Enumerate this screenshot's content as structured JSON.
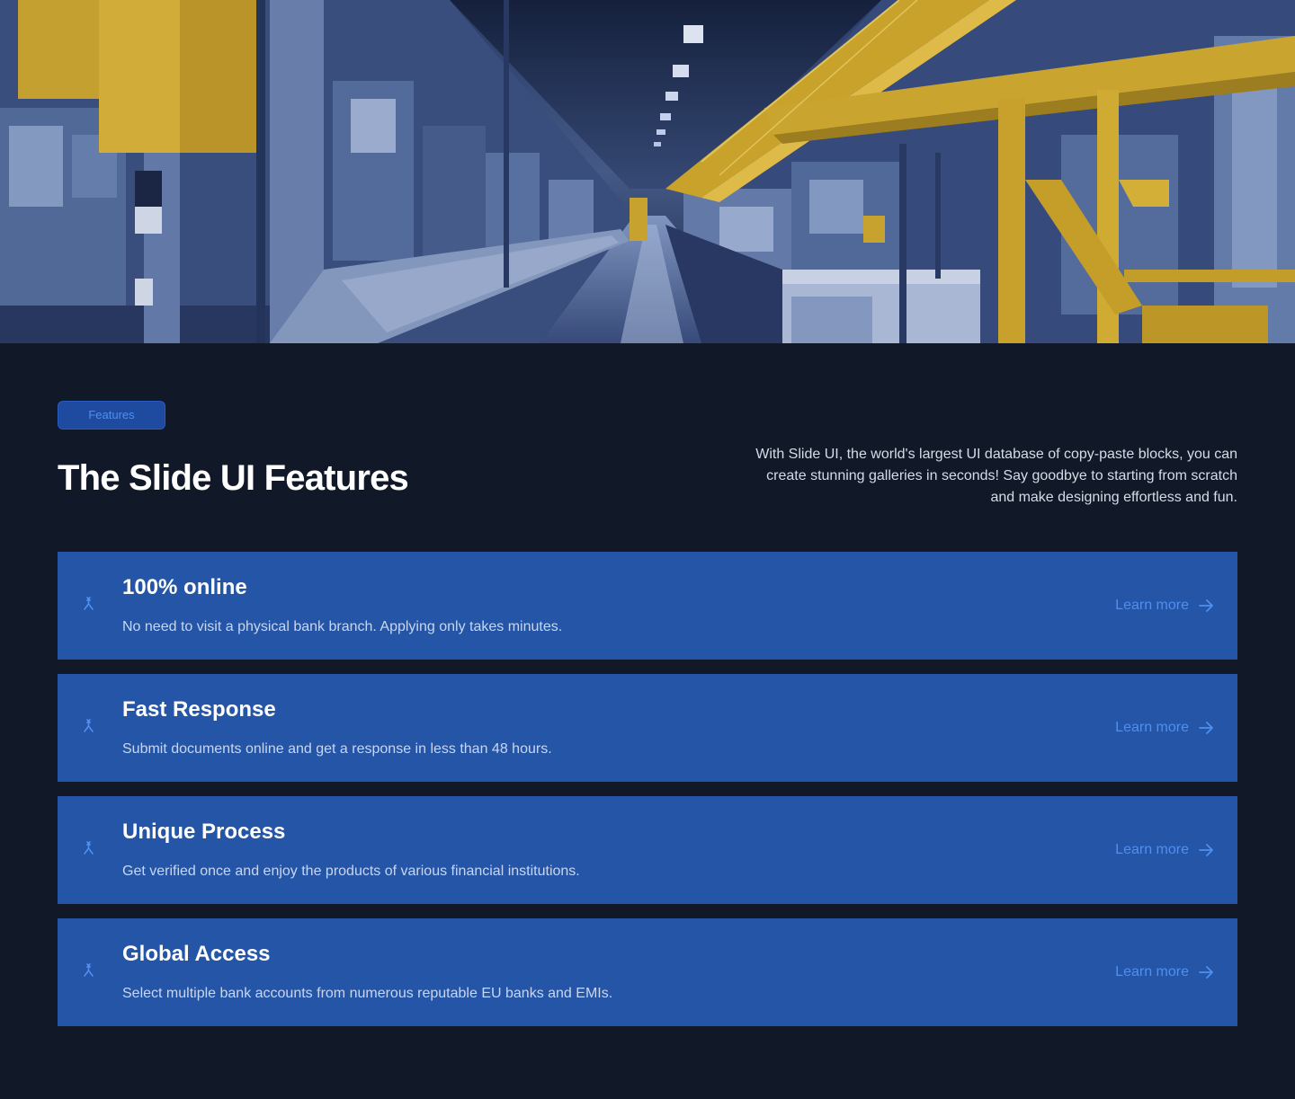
{
  "colors": {
    "background": "#111827",
    "card": "#2455a6",
    "accent": "#4f8ff0",
    "badge_bg": "#1e4a9f"
  },
  "hero": {
    "image_icon": "factory-photo"
  },
  "section": {
    "badge": "Features",
    "title": "The Slide UI Features",
    "description": "With Slide UI, the world's largest UI database of copy-paste blocks, you can create stunning galleries in seconds! Say goodbye to starting from scratch and make designing effortless and fun."
  },
  "features": [
    {
      "icon": "merge-arrow-icon",
      "title": "100% online",
      "description": "No need to visit a physical bank branch. Applying only takes minutes.",
      "link_label": "Learn more"
    },
    {
      "icon": "merge-arrow-icon",
      "title": "Fast Response",
      "description": "Submit documents online and get a response in less than 48 hours.",
      "link_label": "Learn more"
    },
    {
      "icon": "merge-arrow-icon",
      "title": "Unique Process",
      "description": "Get verified once and enjoy the products of various financial institutions.",
      "link_label": "Learn more"
    },
    {
      "icon": "merge-arrow-icon",
      "title": "Global Access",
      "description": "Select multiple bank accounts from numerous reputable EU banks and EMIs.",
      "link_label": "Learn more"
    }
  ]
}
